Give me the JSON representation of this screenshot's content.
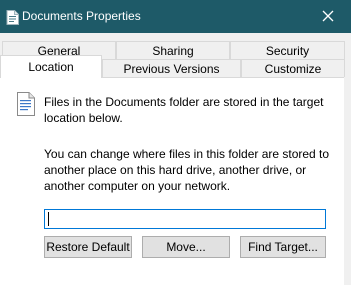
{
  "window": {
    "title": "Documents Properties",
    "icon": "folder-document-icon",
    "close_icon": "close-icon"
  },
  "tabs": {
    "row_back": [
      "General",
      "Sharing",
      "Security"
    ],
    "row_front": [
      "Location",
      "Previous Versions",
      "Customize"
    ],
    "active": "Location"
  },
  "location": {
    "icon": "document-icon",
    "description": "Files in the Documents folder are stored in the target location below.",
    "help_text": "You can change where files in this folder are stored to another place on this hard drive, another drive, or another computer on your network.",
    "path_value": ""
  },
  "buttons": {
    "restore_default": "Restore Default",
    "move": "Move...",
    "find_target": "Find Target..."
  },
  "colors": {
    "titlebar": "#1e5a68",
    "focus_border": "#0078d7",
    "button_bg": "#e1e1e1"
  }
}
